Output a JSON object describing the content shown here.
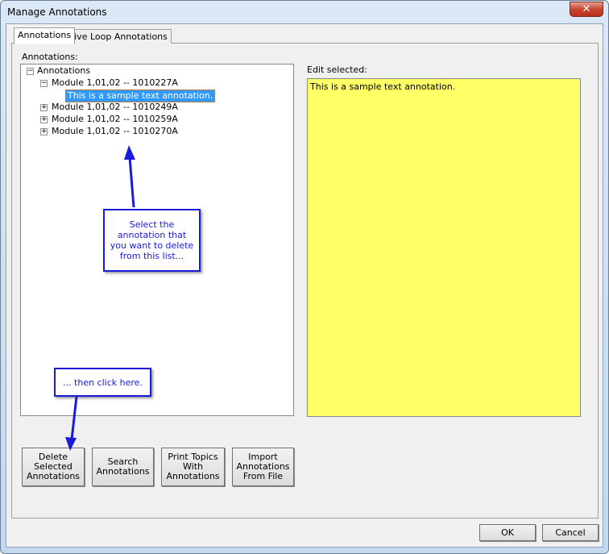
{
  "window": {
    "title": "Manage Annotations",
    "close": "✕"
  },
  "tabs": [
    {
      "label": "Annotations"
    },
    {
      "label": "Live Loop Annotations"
    }
  ],
  "tree": {
    "label": "Annotations:",
    "root": "Annotations",
    "nodes": [
      {
        "label": "Module 1,01,02 -- 1010227A",
        "expanded": true,
        "children": [
          "This is a sample text annotation."
        ]
      },
      {
        "label": "Module 1,01,02 -- 1010249A"
      },
      {
        "label": "Module 1,01,02 -- 1010259A"
      },
      {
        "label": "Module 1,01,02 -- 1010270A"
      }
    ]
  },
  "edit": {
    "label": "Edit selected:",
    "value": "This is a sample text annotation."
  },
  "buttons": {
    "delete": "Delete\nSelected\nAnnotations",
    "search": "Search\nAnnotations",
    "print": "Print Topics\nWith\nAnnotations",
    "import": "Import\nAnnotations\nFrom File",
    "ok": "OK",
    "cancel": "Cancel"
  },
  "callouts": {
    "select": "Select the annotation that you want to delete from this list...",
    "click": "... then click here."
  },
  "colors": {
    "callout": "#1a1adb",
    "edit_bg": "#ffff66",
    "selection": "#3399ff"
  }
}
